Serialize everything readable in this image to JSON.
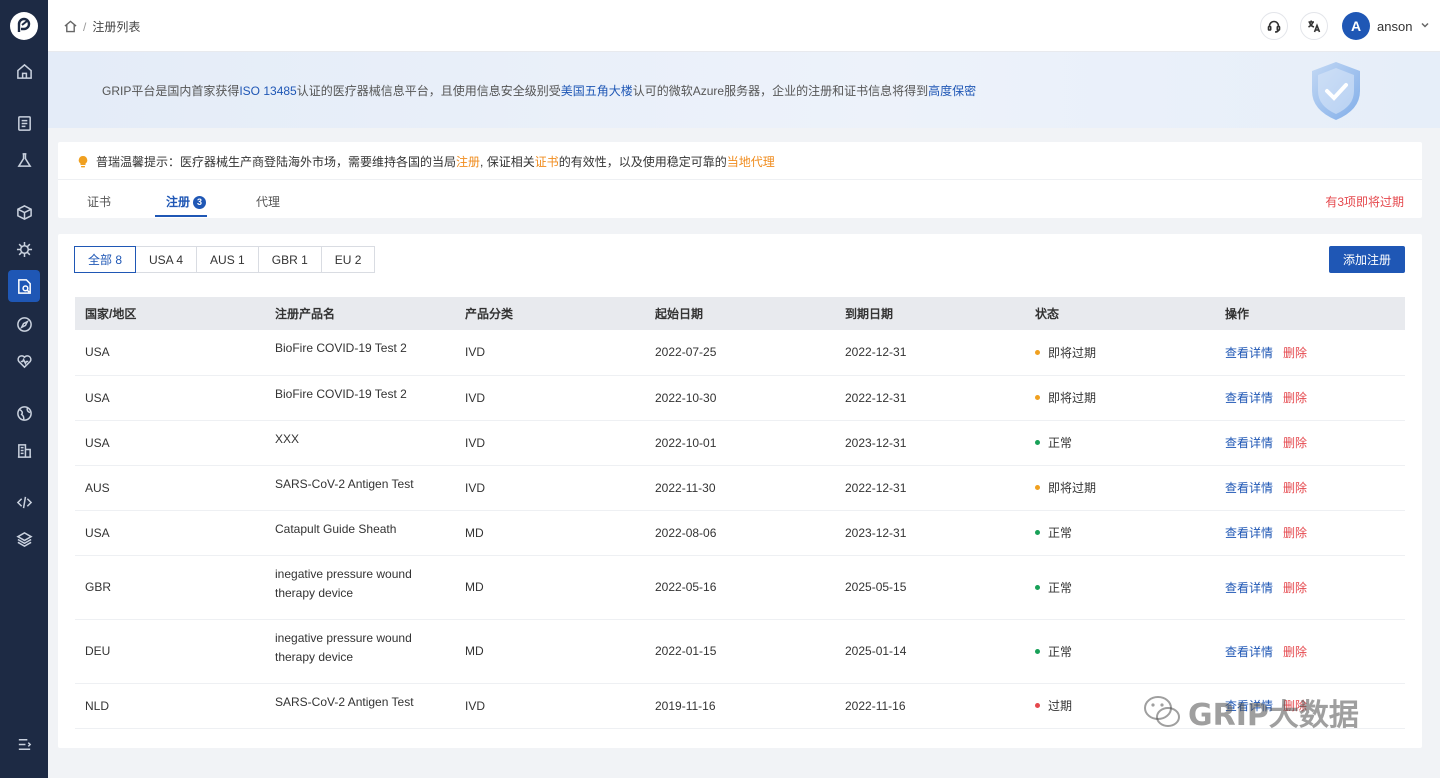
{
  "breadcrumb": {
    "current": "注册列表"
  },
  "user": {
    "initial": "A",
    "name": "anson"
  },
  "banner": {
    "t1": "GRIP平台是国内首家获得",
    "hl1": "ISO 13485",
    "t2": "认证的医疗器械信息平台，且使用信息安全级别受",
    "hl2": "美国五角大楼",
    "t3": "认可的微软Azure服务器，企业的注册和证书信息将得到",
    "hl3": "高度保密"
  },
  "tip": {
    "t1": "普瑞温馨提示：医疗器械生产商登陆海外市场，需要维持各国的当局",
    "hl1": "注册",
    "t2": ", 保证相关",
    "hl2": "证书",
    "t3": "的有效性，以及使用稳定可靠的",
    "hl3": "当地代理"
  },
  "tabs": {
    "cert": "证书",
    "reg": "注册",
    "reg_count": "3",
    "agent": "代理"
  },
  "expire_note": "有3项即将过期",
  "filters": [
    "全部 8",
    "USA 4",
    "AUS 1",
    "GBR 1",
    "EU 2"
  ],
  "add_button": "添加注册",
  "columns": [
    "国家/地区",
    "注册产品名",
    "产品分类",
    "起始日期",
    "到期日期",
    "状态",
    "操作"
  ],
  "rows": [
    {
      "country": "USA",
      "name1": "BioFire COVID-19 Test 2",
      "name2": "",
      "category": "IVD",
      "start": "2022-07-25",
      "end": "2022-12-31",
      "status": "即将过期",
      "status_type": "warn"
    },
    {
      "country": "USA",
      "name1": "BioFire COVID-19 Test 2",
      "name2": "",
      "category": "IVD",
      "start": "2022-10-30",
      "end": "2022-12-31",
      "status": "即将过期",
      "status_type": "warn"
    },
    {
      "country": "USA",
      "name1": "XXX",
      "name2": "",
      "category": "IVD",
      "start": "2022-10-01",
      "end": "2023-12-31",
      "status": "正常",
      "status_type": "ok"
    },
    {
      "country": "AUS",
      "name1": "SARS-CoV-2 Antigen Test",
      "name2": "",
      "category": "IVD",
      "start": "2022-11-30",
      "end": "2022-12-31",
      "status": "即将过期",
      "status_type": "warn"
    },
    {
      "country": "USA",
      "name1": "Catapult Guide Sheath",
      "name2": "",
      "category": "MD",
      "start": "2022-08-06",
      "end": "2023-12-31",
      "status": "正常",
      "status_type": "ok"
    },
    {
      "country": "GBR",
      "name1": "inegative pressure wound",
      "name2": "therapy device",
      "category": "MD",
      "start": "2022-05-16",
      "end": "2025-05-15",
      "status": "正常",
      "status_type": "ok"
    },
    {
      "country": "DEU",
      "name1": "inegative pressure wound",
      "name2": "therapy device",
      "category": "MD",
      "start": "2022-01-15",
      "end": "2025-01-14",
      "status": "正常",
      "status_type": "ok"
    },
    {
      "country": "NLD",
      "name1": "SARS-CoV-2 Antigen Test",
      "name2": "",
      "category": "IVD",
      "start": "2019-11-16",
      "end": "2022-11-16",
      "status": "过期",
      "status_type": "expired"
    }
  ],
  "actions": {
    "detail": "查看详情",
    "delete": "删除"
  },
  "status_colors": {
    "warn": "#f0a020",
    "ok": "#18a058",
    "expired": "#e5484d"
  },
  "watermark": "GRIP大数据"
}
